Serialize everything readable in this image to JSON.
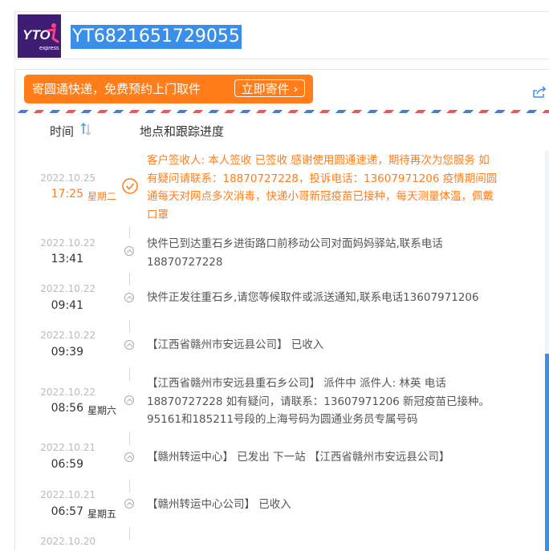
{
  "header": {
    "logo_text": "YTO",
    "logo_sub": "express",
    "tracking_number": "YT6821651729055"
  },
  "banner": {
    "text": "寄圆通快递，免费预约上门取件",
    "button_label": "立即寄件",
    "button_arrow": "›"
  },
  "columns": {
    "time": "时间",
    "place": "地点和跟踪进度"
  },
  "colors": {
    "accent": "#ff7d1a",
    "brand": "#3d1e73",
    "link": "#3b8fe8"
  },
  "events": [
    {
      "date": "2022.10.25",
      "time": "17:25",
      "weekday": "星期二",
      "desc": "客户签收人: 本人签收 已签收 感谢使用圆通速递，期待再次为您服务 如有疑问请联系：18870727228，投诉电话：13607971206 疫情期间圆通每天对网点多次消毒，快递小哥新冠疫苗已接种，每天测量体温，佩戴口罩",
      "current": true
    },
    {
      "date": "2022.10.22",
      "time": "13:41",
      "weekday": "",
      "desc": "快件已到达重石乡进街路口前移动公司对面妈妈驿站,联系电话 18870727228"
    },
    {
      "date": "2022.10.22",
      "time": "09:41",
      "weekday": "",
      "desc": "快件正发往重石乡,请您等候取件或派送通知,联系电话13607971206"
    },
    {
      "date": "2022.10.22",
      "time": "09:39",
      "weekday": "",
      "desc": "【江西省赣州市安远县公司】 已收入"
    },
    {
      "date": "2022.10.22",
      "time": "08:56",
      "weekday": "星期六",
      "desc": "【江西省赣州市安远县重石乡公司】 派件中 派件人: 林英 电话 18870727228 如有疑问，请联系：13607971206 新冠疫苗已接种。95161和185211号段的上海号码为圆通业务员专属号码"
    },
    {
      "date": "2022.10.21",
      "time": "06:59",
      "weekday": "",
      "desc": "【赣州转运中心】 已发出 下一站 【江西省赣州市安远县公司】"
    },
    {
      "date": "2022.10.21",
      "time": "06:57",
      "weekday": "星期五",
      "desc": "【赣州转运中心公司】 已收入"
    },
    {
      "date": "2022.10.20",
      "time": "",
      "weekday": "",
      "desc": ""
    }
  ]
}
